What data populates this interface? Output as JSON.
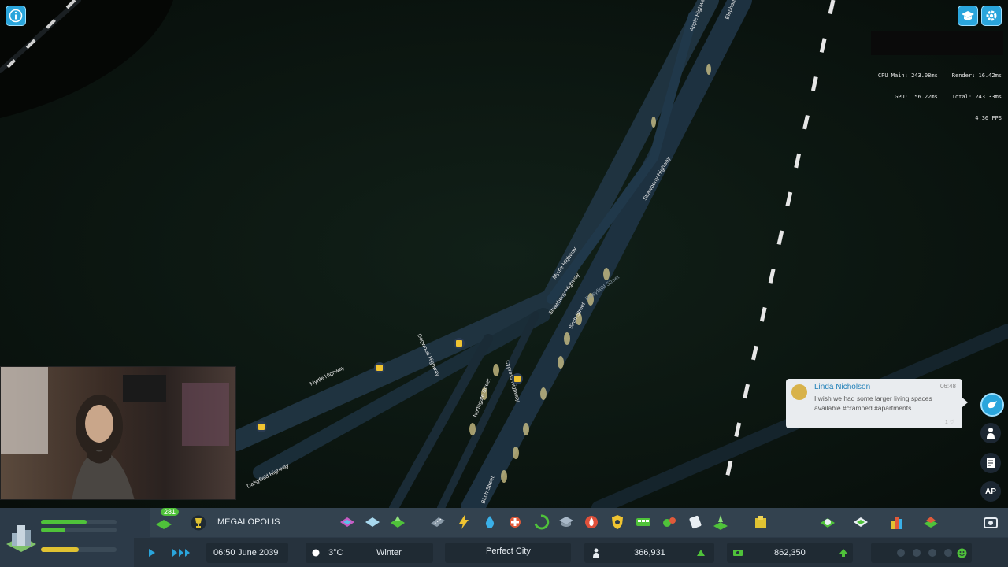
{
  "perf": {
    "cpu_main": "CPU Main: 243.08ms",
    "render": "Render: 16.42ms",
    "gpu": "GPU: 156.22ms",
    "total": "Total: 243.33ms",
    "fps": "4.36 FPS"
  },
  "roads": {
    "myrtle_1": "Myrtle Highway",
    "myrtle_2": "Myrtle Highway",
    "dogwood": "Dogwood Highway",
    "daisyfield": "Daisyfield Highway",
    "strawberry_1": "Strawberry Highway",
    "strawberry_2": "Strawberry Highway",
    "birch": "Birch Street",
    "birch_2": "Birch Street",
    "cypress": "Cypress Highway",
    "northgate": "Northgate Street",
    "daisyfield_2": "Daisyfield Street",
    "apple": "Apple Highway",
    "elephant": "Elephant Highway"
  },
  "chirp": {
    "author": "Linda Nicholson",
    "time": "06:48",
    "message": "I wish we had some larger living spaces available #cramped #apartments",
    "likes": "1 ♡"
  },
  "side_buttons": {
    "ap_label": "AP"
  },
  "bottom_bar": {
    "level_badge": "281",
    "milestone": "MEGALOPOLIS",
    "time": "06:50",
    "date": "June 2039",
    "temperature": "3°C",
    "season": "Winter",
    "city_status": "Perfect City",
    "population": "366,931",
    "money": "862,350",
    "progress": {
      "happiness": 0.6,
      "mid": 0.32,
      "lower": 0.5
    }
  },
  "colors": {
    "accent": "#2aa5dc",
    "bar_bg": "#2c3a48",
    "green": "#4fc23a",
    "yellow": "#e0c232"
  },
  "icons": [
    "info-icon",
    "graduation-cap-icon",
    "gear-icon",
    "chirper-icon",
    "citizen-icon",
    "notes-icon",
    "ap-icon",
    "camera-icon"
  ]
}
